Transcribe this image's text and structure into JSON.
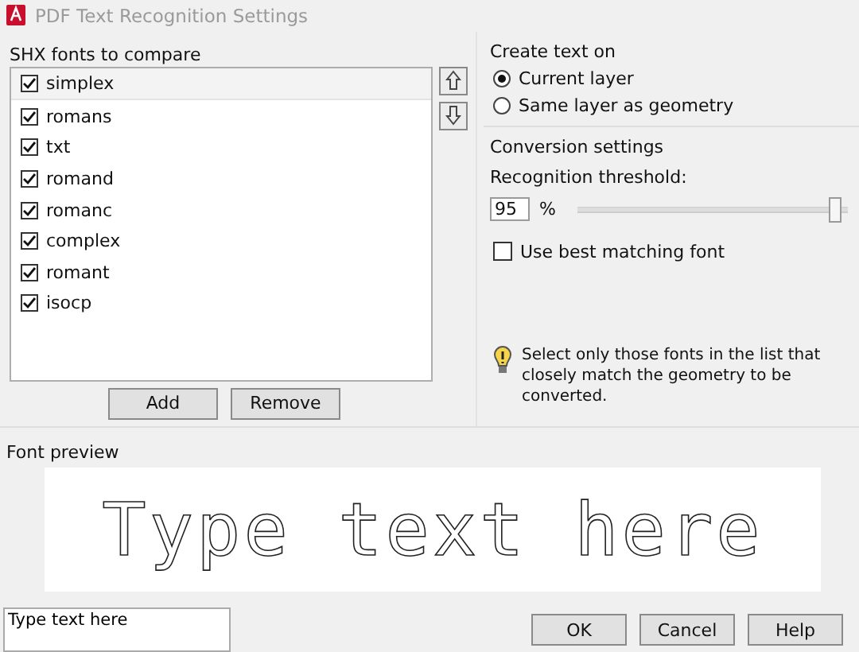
{
  "window": {
    "title": "PDF Text Recognition Settings"
  },
  "fonts": {
    "label": "SHX fonts to compare",
    "items": [
      {
        "name": "simplex",
        "checked": true,
        "selected": true
      },
      {
        "name": "romans",
        "checked": true,
        "selected": false
      },
      {
        "name": "txt",
        "checked": true,
        "selected": false
      },
      {
        "name": "romand",
        "checked": true,
        "selected": false
      },
      {
        "name": "romanc",
        "checked": true,
        "selected": false
      },
      {
        "name": "complex",
        "checked": true,
        "selected": false
      },
      {
        "name": "romant",
        "checked": true,
        "selected": false
      },
      {
        "name": "isocp",
        "checked": true,
        "selected": false
      }
    ],
    "buttons": [
      "Add",
      "Remove"
    ]
  },
  "create_text_on": {
    "label": "Create text on",
    "options": [
      {
        "label": "Current layer",
        "selected": true
      },
      {
        "label": "Same layer as geometry",
        "selected": false
      }
    ]
  },
  "conversion": {
    "label": "Conversion settings",
    "threshold_label": "Recognition threshold:",
    "threshold_value": "95",
    "unit": "%",
    "level": 0.95,
    "best_match": {
      "label": "Use best matching font",
      "checked": false
    },
    "tip": "Select only those fonts in the list that closely match the geometry to be converted."
  },
  "preview": {
    "label": "Font preview",
    "text": "Type text here"
  },
  "sample_input": {
    "value": "Type text here"
  },
  "buttons": [
    "OK",
    "Cancel",
    "Help"
  ]
}
